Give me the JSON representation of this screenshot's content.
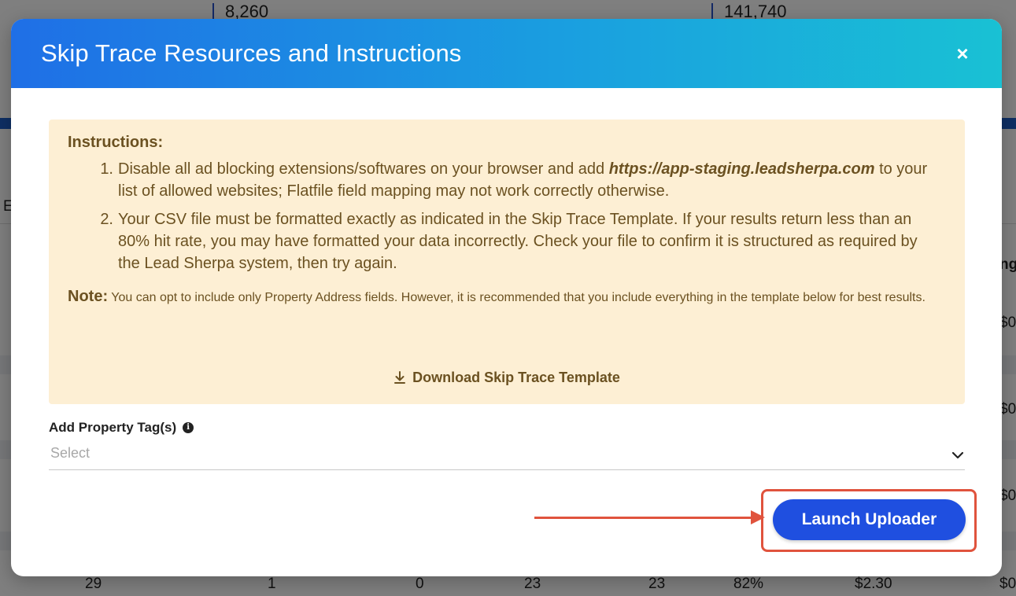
{
  "background": {
    "stats": [
      "8,260",
      "141,740"
    ],
    "bottom_row": [
      "29",
      "1",
      "0",
      "23",
      "23",
      "82%",
      "$2.30",
      "$0"
    ],
    "side_fragments": {
      "left": "E",
      "right_header": "ng",
      "right_values": [
        "$0",
        "$0",
        "$0"
      ]
    }
  },
  "modal": {
    "title": "Skip Trace Resources and Instructions",
    "close_symbol": "×",
    "instructions": {
      "heading": "Instructions:",
      "items": [
        {
          "number": "1.",
          "before_link": "Disable all ad blocking extensions/softwares on your browser and add ",
          "link": "https://app-staging.leadsherpa.com",
          "after_link": " to your list of allowed websites; Flatfile field mapping may not work correctly otherwise."
        },
        {
          "number": "2.",
          "text": "Your CSV file must be formatted exactly as indicated in the Skip Trace Template. If your results return less than an 80% hit rate, you may have formatted your data incorrectly. Check your file to confirm it is structured as required by the Lead Sherpa system, then try again."
        }
      ],
      "note_label": "Note:",
      "note_text": " You can opt to include only Property Address fields. However, it is recommended that you include everything in the template below for best results.",
      "download_label": "Download Skip Trace Template"
    },
    "tag_field": {
      "label": "Add Property Tag(s)",
      "info_symbol": "i",
      "placeholder": "Select"
    },
    "launch_button": "Launch Uploader"
  },
  "colors": {
    "header_gradient_start": "#1f6fe6",
    "header_gradient_end": "#19c1d4",
    "instructions_bg": "#fdefd4",
    "instructions_text": "#6b5121",
    "button_bg": "#1f4fe0",
    "annotation": "#e0533d"
  }
}
